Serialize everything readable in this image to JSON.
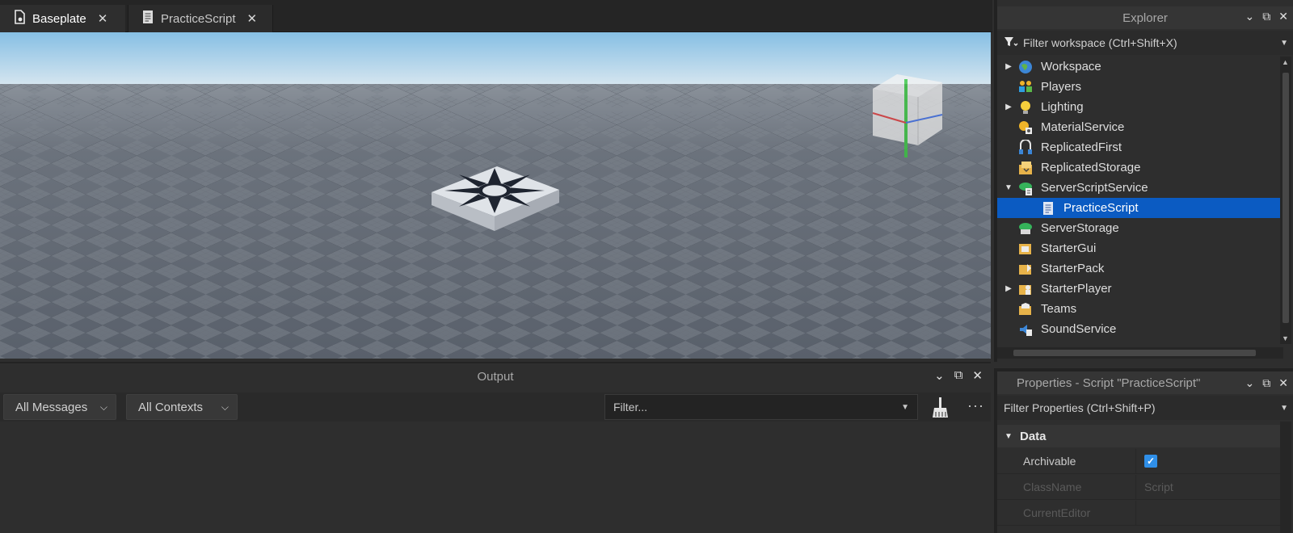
{
  "tabs": [
    {
      "label": "Baseplate",
      "icon": "place-icon"
    },
    {
      "label": "PracticeScript",
      "icon": "script-icon"
    }
  ],
  "output": {
    "title": "Output",
    "messages_dropdown": "All Messages",
    "contexts_dropdown": "All Contexts",
    "filter_placeholder": "Filter..."
  },
  "explorer": {
    "title": "Explorer",
    "filter_placeholder": "Filter workspace (Ctrl+Shift+X)",
    "items": [
      {
        "label": "Workspace",
        "expander": "collapsed",
        "icon": "workspace-icon"
      },
      {
        "label": "Players",
        "expander": "none",
        "icon": "players-icon"
      },
      {
        "label": "Lighting",
        "expander": "collapsed",
        "icon": "lighting-icon"
      },
      {
        "label": "MaterialService",
        "expander": "none",
        "icon": "material-service-icon"
      },
      {
        "label": "ReplicatedFirst",
        "expander": "none",
        "icon": "replicated-first-icon"
      },
      {
        "label": "ReplicatedStorage",
        "expander": "none",
        "icon": "replicated-storage-icon"
      },
      {
        "label": "ServerScriptService",
        "expander": "expanded",
        "icon": "server-script-service-icon"
      },
      {
        "label": "PracticeScript",
        "expander": "none",
        "icon": "script-icon",
        "selected": true,
        "indent": 1
      },
      {
        "label": "ServerStorage",
        "expander": "none",
        "icon": "server-storage-icon"
      },
      {
        "label": "StarterGui",
        "expander": "none",
        "icon": "starter-gui-icon"
      },
      {
        "label": "StarterPack",
        "expander": "none",
        "icon": "starter-pack-icon"
      },
      {
        "label": "StarterPlayer",
        "expander": "collapsed",
        "icon": "starter-player-icon"
      },
      {
        "label": "Teams",
        "expander": "none",
        "icon": "teams-icon"
      },
      {
        "label": "SoundService",
        "expander": "none",
        "icon": "sound-service-icon"
      }
    ]
  },
  "properties": {
    "title": "Properties - Script \"PracticeScript\"",
    "filter_placeholder": "Filter Properties (Ctrl+Shift+P)",
    "section": "Data",
    "rows": [
      {
        "name": "Archivable",
        "value": "",
        "checked": true
      },
      {
        "name": "ClassName",
        "value": "Script"
      },
      {
        "name": "CurrentEditor",
        "value": ""
      }
    ]
  },
  "colors": {
    "selection": "#0b5bc2",
    "checkbox": "#2f8fe8",
    "sky_top": "#86bfe4",
    "ground": "#59606b"
  }
}
